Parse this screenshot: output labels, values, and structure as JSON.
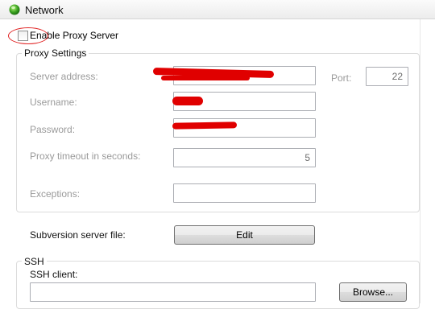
{
  "header": {
    "title": "Network",
    "icon": "green-globe-icon"
  },
  "proxy": {
    "enable_label": "Enable Proxy Server",
    "enabled": false,
    "group_title": "Proxy Settings",
    "server_address_label": "Server address:",
    "port_label": "Port:",
    "port_value": "22",
    "username_label": "Username:",
    "password_label": "Password:",
    "timeout_label": "Proxy timeout in seconds:",
    "timeout_value": "5",
    "exceptions_label": "Exceptions:"
  },
  "subversion": {
    "server_file_label": "Subversion server file:",
    "edit_button": "Edit"
  },
  "ssh": {
    "group_title": "SSH",
    "client_label": "SSH client:",
    "browse_button": "Browse..."
  },
  "colors": {
    "annotation": "#e02020",
    "redaction": "#e00000"
  }
}
